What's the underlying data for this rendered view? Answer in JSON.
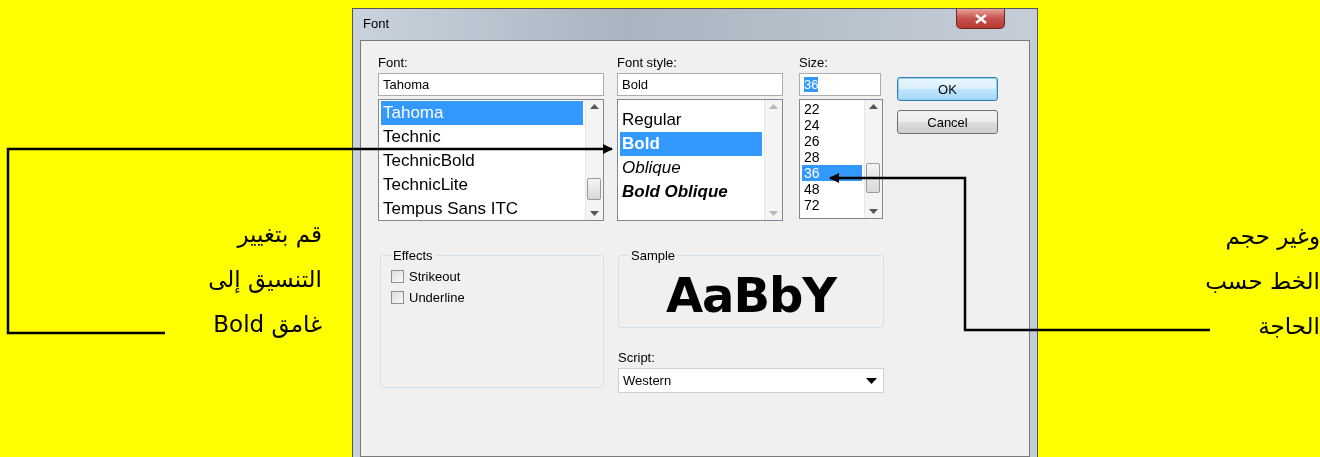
{
  "window": {
    "title": "Font"
  },
  "font": {
    "label": "Font:",
    "value": "Tahoma",
    "items": [
      {
        "text": "Tahoma",
        "selected": true
      },
      {
        "text": "Technic",
        "selected": false
      },
      {
        "text": "TechnicBold",
        "selected": false
      },
      {
        "text": "TechnicLite",
        "selected": false
      },
      {
        "text": "Tempus Sans ITC",
        "selected": false
      }
    ]
  },
  "font_style": {
    "label": "Font style:",
    "value": "Bold",
    "items": [
      {
        "text": "Regular",
        "kind": "regular",
        "selected": false
      },
      {
        "text": "Bold",
        "kind": "bold",
        "selected": true
      },
      {
        "text": "Oblique",
        "kind": "italic",
        "selected": false
      },
      {
        "text": "Bold Oblique",
        "kind": "bolditalic",
        "selected": false
      }
    ]
  },
  "size": {
    "label": "Size:",
    "value": "36",
    "items": [
      {
        "text": "22",
        "selected": false
      },
      {
        "text": "24",
        "selected": false
      },
      {
        "text": "26",
        "selected": false
      },
      {
        "text": "28",
        "selected": false
      },
      {
        "text": "36",
        "selected": true
      },
      {
        "text": "48",
        "selected": false
      },
      {
        "text": "72",
        "selected": false
      }
    ]
  },
  "buttons": [
    {
      "label": "OK",
      "default": true
    },
    {
      "label": "Cancel",
      "default": false
    }
  ],
  "effects": {
    "title": "Effects",
    "options": [
      {
        "label": "Strikeout",
        "checked": false
      },
      {
        "label": "Underline",
        "checked": false
      }
    ]
  },
  "sample": {
    "title": "Sample",
    "text": "AaBbY"
  },
  "script": {
    "label": "Script:",
    "value": "Western"
  },
  "annotations": [
    {
      "lines": [
        "وغير حجم",
        "الخط حسب",
        "الحاجة"
      ]
    },
    {
      "lines": [
        "قم بتغيير",
        "التنسيق إلى",
        "غامق Bold"
      ]
    }
  ]
}
